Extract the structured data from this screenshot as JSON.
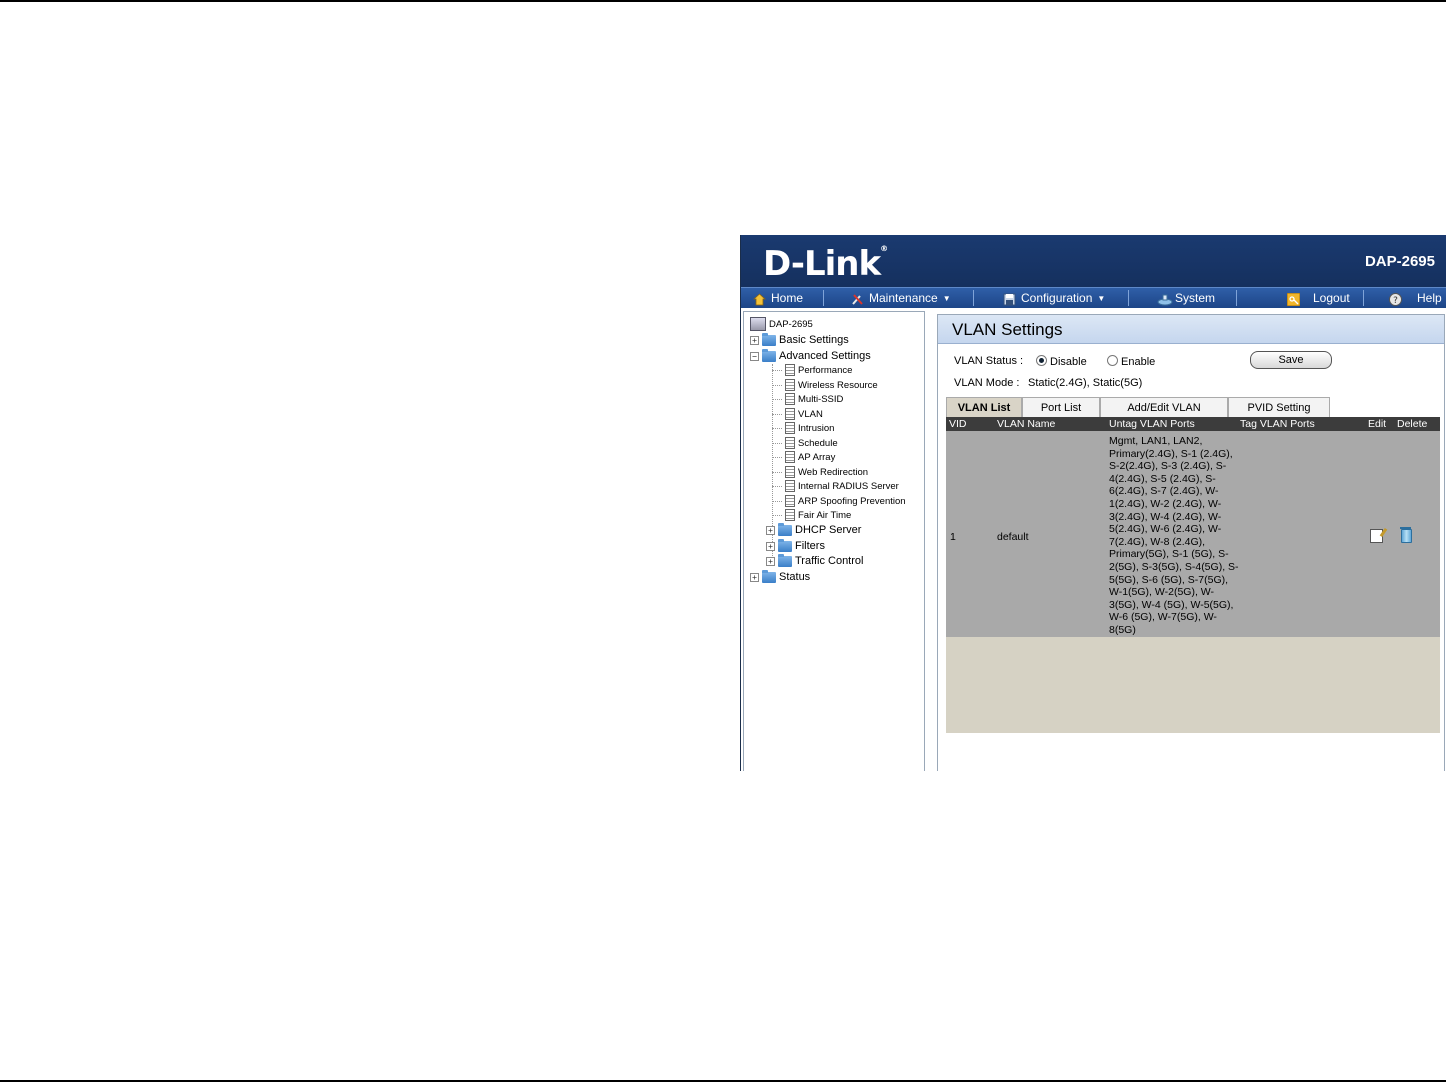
{
  "header": {
    "brand": "D-Link",
    "model": "DAP-2695"
  },
  "menu": [
    {
      "label": "Home",
      "icon": "home-icon"
    },
    {
      "label": "Maintenance",
      "icon": "tools-icon",
      "dropdown": true
    },
    {
      "label": "Configuration",
      "icon": "save-disk-icon",
      "dropdown": true
    },
    {
      "label": "System",
      "icon": "system-icon"
    },
    {
      "label": "Logout",
      "icon": "key-icon"
    },
    {
      "label": "Help",
      "icon": "help-icon"
    }
  ],
  "tree": {
    "root": "DAP-2695",
    "basic": "Basic Settings",
    "advanced": "Advanced Settings",
    "advanced_items": [
      "Performance",
      "Wireless Resource",
      "Multi-SSID",
      "VLAN",
      "Intrusion",
      "Schedule",
      "AP Array",
      "Web Redirection",
      "Internal RADIUS Server",
      "ARP Spoofing Prevention",
      "Fair Air Time"
    ],
    "advanced_folders": [
      "DHCP Server",
      "Filters",
      "Traffic Control"
    ],
    "status": "Status"
  },
  "vlan": {
    "title": "VLAN Settings",
    "status_label": "VLAN Status  :",
    "disable_label": "Disable",
    "enable_label": "Enable",
    "selected": "Disable",
    "save_label": "Save",
    "mode_label": "VLAN Mode  :",
    "mode_value": "Static(2.4G),  Static(5G)",
    "tabs": [
      "VLAN List",
      "Port List",
      "Add/Edit VLAN",
      "PVID Setting"
    ],
    "active_tab": "VLAN List",
    "columns": {
      "vid": "VID",
      "name": "VLAN Name",
      "untag": "Untag VLAN Ports",
      "tag": "Tag VLAN Ports",
      "edit": "Edit",
      "delete": "Delete"
    },
    "rows": [
      {
        "vid": "1",
        "name": "default",
        "untag": "Mgmt, LAN1, LAN2, Primary(2.4G), S-1 (2.4G), S-2(2.4G), S-3 (2.4G), S-4(2.4G), S-5 (2.4G), S-6(2.4G), S-7 (2.4G), W-1(2.4G), W-2 (2.4G), W-3(2.4G), W-4 (2.4G), W-5(2.4G), W-6 (2.4G), W-7(2.4G), W-8 (2.4G), Primary(5G), S-1 (5G), S-2(5G), S-3(5G), S-4(5G), S-5(5G), S-6 (5G), S-7(5G), W-1(5G), W-2(5G), W-3(5G), W-4 (5G), W-5(5G), W-6 (5G), W-7(5G), W-8(5G)",
        "tag": ""
      }
    ]
  },
  "colors": {
    "header": "#15305e",
    "menubar": "#1d4587",
    "grid_header": "#3c3c3c",
    "row": "#a9a9a9",
    "grid_bg": "#d6d2c4"
  }
}
